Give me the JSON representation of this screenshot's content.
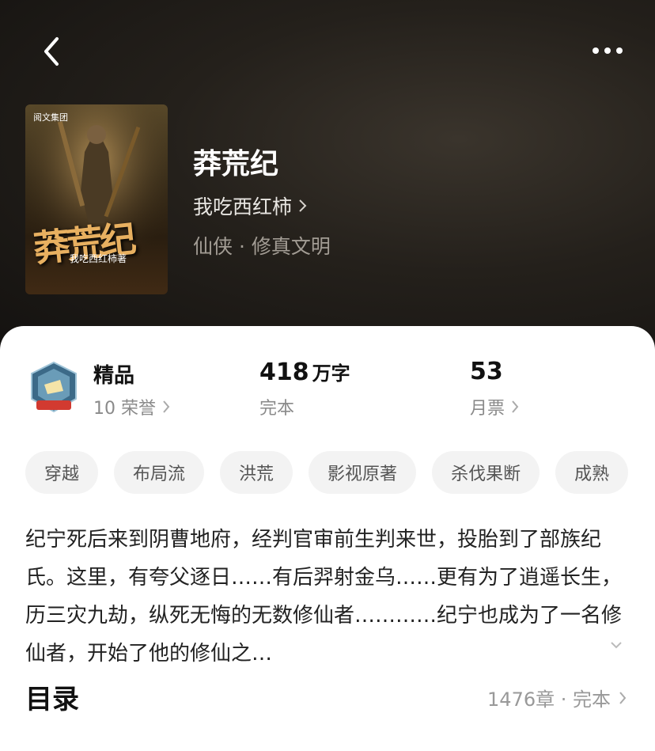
{
  "book": {
    "title": "莽荒纪",
    "author": "我吃西红柿",
    "genre": "仙侠 · 修真文明",
    "cover_publisher": "阅文集团",
    "cover_title": "莽荒纪",
    "cover_author": "我吃西红柿著"
  },
  "stats": {
    "honor_title": "精品",
    "honor_sub": "10 荣誉",
    "words_value": "418",
    "words_unit": "万字",
    "words_sub": "完本",
    "tickets_value": "53",
    "tickets_sub": "月票"
  },
  "tags": [
    "穿越",
    "布局流",
    "洪荒",
    "影视原著",
    "杀伐果断",
    "成熟"
  ],
  "description": "纪宁死后来到阴曹地府，经判官审前生判来世，投胎到了部族纪氏。这里，有夸父逐日……有后羿射金乌……更有为了逍遥长生，历三灾九劫，纵死无悔的无数修仙者…………纪宁也成为了一名修仙者，开始了他的修仙之…",
  "toc": {
    "label": "目录",
    "info": "1476章 · 完本"
  },
  "icons": {
    "back": "back-chevron-icon",
    "more": "more-dots-icon",
    "badge": "honor-badge-icon",
    "chevron": "chevron-right-icon",
    "expand": "chevron-down-icon"
  },
  "colors": {
    "hero_bg": "#1a1714",
    "card_bg": "#ffffff",
    "tag_bg": "#f3f3f3"
  }
}
